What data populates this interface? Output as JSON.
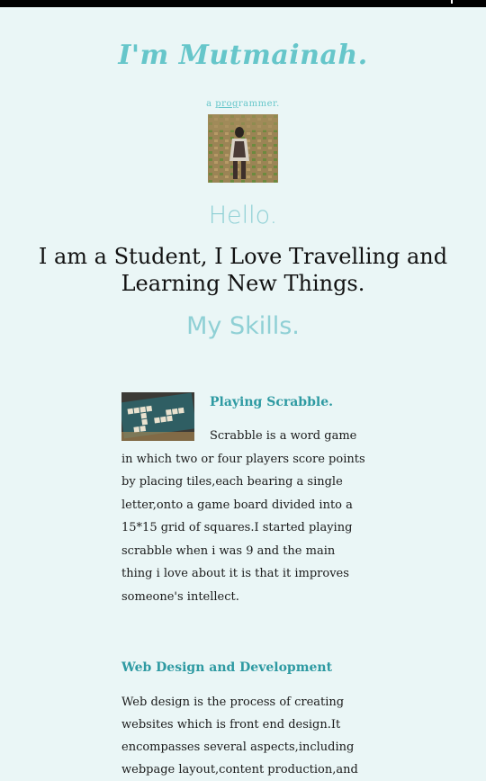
{
  "site": {
    "title": "I'm Mutmainah.",
    "subtitle_prefix": "a ",
    "subtitle_underlined": "prog",
    "subtitle_suffix": "rammer."
  },
  "hero": {
    "greeting": "Hello.",
    "intro": "I am a Student, I Love Travelling and Learning New Things.",
    "skills_heading": "My Skills."
  },
  "skills": [
    {
      "title": "Playing Scrabble.",
      "description": "Scrabble is a word game in which two or four players score points by placing tiles,each bearing a single letter,onto a game board divided into a 15*15 grid of squares.I started playing scrabble when i was 9 and the main thing i love about it is that it improves someone's intellect."
    },
    {
      "title": "Web Design and Development",
      "description": "Web design is the process of creating websites which is front end design.It encompasses several aspects,including webpage layout,content production,and"
    }
  ]
}
